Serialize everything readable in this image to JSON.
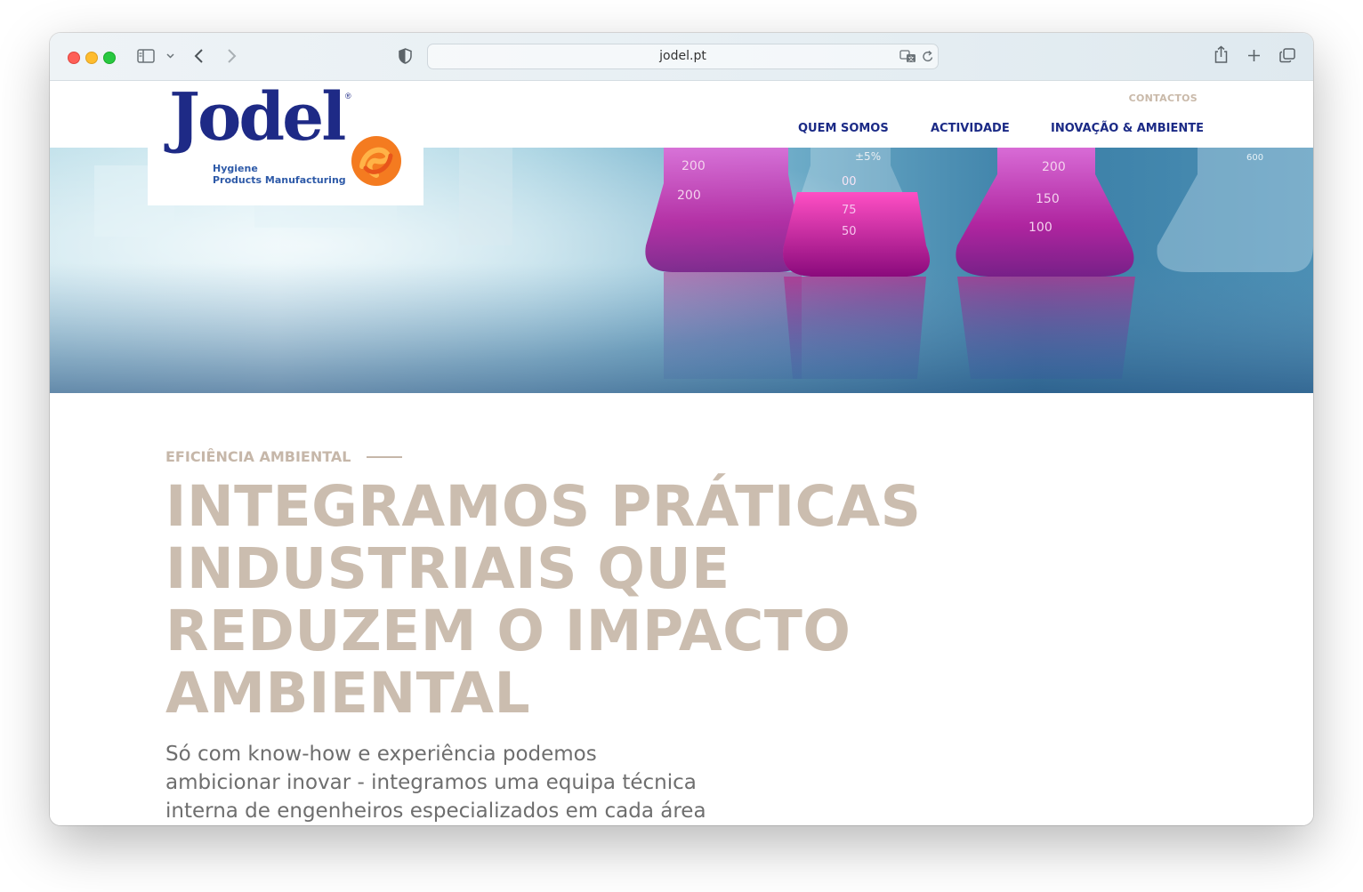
{
  "browser": {
    "url": "jodel.pt"
  },
  "header": {
    "logo": {
      "wordmark": "Jodel",
      "registered": "®",
      "tagline_1": "Hygiene",
      "tagline_2": "Products Manufacturing"
    },
    "contact_link": "CONTACTOS",
    "nav": [
      "QUEM SOMOS",
      "ACTIVIDADE",
      "INOVAÇÃO & AMBIENTE"
    ]
  },
  "hero": {
    "flask_marks": [
      "200",
      "200",
      "±5%",
      "00",
      "75",
      "50",
      "200",
      "150",
      "100",
      "600"
    ]
  },
  "section": {
    "eyebrow": "EFICIÊNCIA AMBIENTAL",
    "headline_lines": [
      "INTEGRAMOS PRÁTICAS",
      "INDUSTRIAIS QUE",
      "REDUZEM O IMPACTO",
      "AMBIENTAL"
    ],
    "lead_lines": [
      "Só com know-how e experiência podemos",
      "ambicionar inovar - integramos uma equipa técnica",
      "interna de engenheiros especializados em cada área"
    ]
  },
  "colors": {
    "brand_blue": "#1b2a86",
    "accent_beige": "#c6b7a9",
    "logo_orange": "#f47b20"
  }
}
